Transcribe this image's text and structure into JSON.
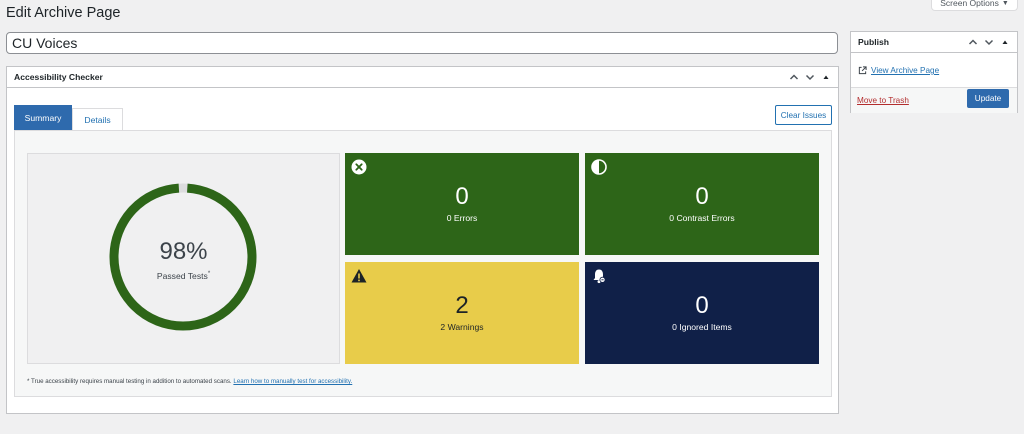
{
  "header": {
    "page_title": "Edit Archive Page",
    "screen_options_label": "Screen Options",
    "screen_options_caret": "▼"
  },
  "editor": {
    "post_title": "CU Voices"
  },
  "accessibility_checker": {
    "title": "Accessibility Checker",
    "tabs": [
      {
        "label": "Summary",
        "active": true
      },
      {
        "label": "Details",
        "active": false
      }
    ],
    "clear_issues_label": "Clear Issues",
    "score": {
      "value_text": "98%",
      "percent": 98,
      "label": "Passed Tests",
      "label_marker": "*",
      "ring_color": "#2d6518",
      "ring_gap_color": "#dcdcde"
    },
    "stats": {
      "errors": {
        "count": "0",
        "label": "0 Errors",
        "icon": "x-circle-icon",
        "color": "#2d6518"
      },
      "contrast": {
        "count": "0",
        "label": "0 Contrast Errors",
        "icon": "contrast-icon",
        "color": "#2d6518"
      },
      "warnings": {
        "count": "2",
        "label": "2 Warnings",
        "icon": "warning-icon",
        "color": "#e8cc4a"
      },
      "ignored": {
        "count": "0",
        "label": "0 Ignored Items",
        "icon": "bell-icon",
        "color": "#102048"
      }
    },
    "footnote": {
      "text": "* True accessibility requires manual testing in addition to automated scans.",
      "link_text": "Learn how to manually test for accessibility."
    }
  },
  "publish": {
    "title": "Publish",
    "view_link": "View Archive Page",
    "trash_label": "Move to Trash",
    "update_label": "Update"
  },
  "colors": {
    "accent_blue": "#2271b1",
    "button_blue": "#2e6aad",
    "trash_red": "#b32d2e"
  }
}
